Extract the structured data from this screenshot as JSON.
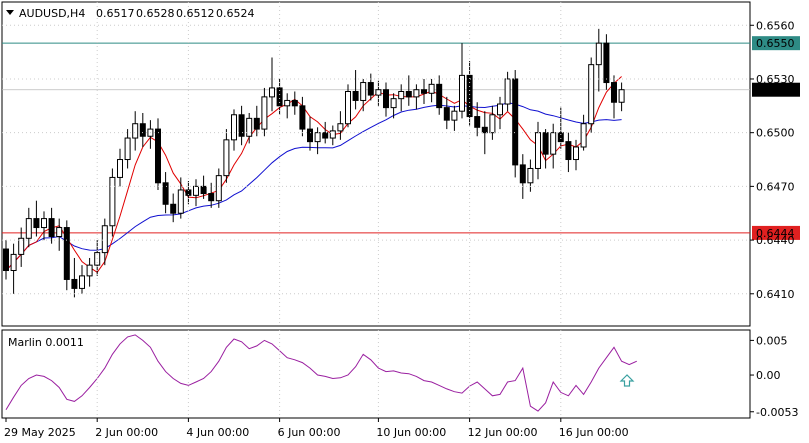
{
  "chart_data": {
    "type": "candlestick",
    "title": "AUDUSD,H4",
    "ohlc_header": {
      "open": "0.6517",
      "high": "0.6528",
      "low": "0.6512",
      "close": "0.6524"
    },
    "price_axis": {
      "ticks": [
        "0.6560",
        "0.6530",
        "0.6500",
        "0.6470",
        "0.6440",
        "0.6410"
      ],
      "range": [
        0.6392,
        0.6573
      ]
    },
    "x_axis_labels": [
      "29 May 2025",
      "2 Jun 00:00",
      "4 Jun 00:00",
      "6 Jun 00:00",
      "10 Jun 00:00",
      "12 Jun 00:00",
      "16 Jun 00:00"
    ],
    "horizontal_levels": [
      {
        "value": "0.6550",
        "color": "#2e8b85"
      },
      {
        "value": "0.6444",
        "color": "#e02020"
      }
    ],
    "current_price": "0.6524",
    "colors": {
      "fast_ma": "#e00000",
      "slow_ma": "#1010d0",
      "oscillator": "#9a1fa0",
      "arrow": "#3aa0a0",
      "grid": "#cccccc"
    },
    "candles": [
      [
        0.6435,
        0.644,
        0.6418,
        0.6423
      ],
      [
        0.6423,
        0.6438,
        0.641,
        0.6432
      ],
      [
        0.6432,
        0.6447,
        0.6425,
        0.6441
      ],
      [
        0.6441,
        0.6458,
        0.6436,
        0.6452
      ],
      [
        0.6452,
        0.6462,
        0.6442,
        0.6447
      ],
      [
        0.6447,
        0.6456,
        0.644,
        0.6452
      ],
      [
        0.6452,
        0.6458,
        0.6438,
        0.6442
      ],
      [
        0.6442,
        0.6452,
        0.6434,
        0.6447
      ],
      [
        0.6447,
        0.6451,
        0.6412,
        0.6418
      ],
      [
        0.6418,
        0.643,
        0.6408,
        0.6413
      ],
      [
        0.6413,
        0.6426,
        0.641,
        0.642
      ],
      [
        0.642,
        0.643,
        0.6414,
        0.6426
      ],
      [
        0.6426,
        0.644,
        0.642,
        0.6433
      ],
      [
        0.6433,
        0.6452,
        0.6426,
        0.6448
      ],
      [
        0.6448,
        0.648,
        0.6442,
        0.6475
      ],
      [
        0.6475,
        0.6491,
        0.647,
        0.6485
      ],
      [
        0.6485,
        0.6502,
        0.648,
        0.6497
      ],
      [
        0.6497,
        0.6512,
        0.649,
        0.6505
      ],
      [
        0.6505,
        0.6511,
        0.6492,
        0.6498
      ],
      [
        0.6498,
        0.6507,
        0.6491,
        0.6502
      ],
      [
        0.6502,
        0.6508,
        0.6468,
        0.6472
      ],
      [
        0.6472,
        0.6478,
        0.6455,
        0.646
      ],
      [
        0.646,
        0.6466,
        0.645,
        0.6455
      ],
      [
        0.6455,
        0.6475,
        0.6452,
        0.6468
      ],
      [
        0.6468,
        0.6473,
        0.646,
        0.6465
      ],
      [
        0.6465,
        0.6474,
        0.6459,
        0.647
      ],
      [
        0.647,
        0.6476,
        0.6463,
        0.6466
      ],
      [
        0.6466,
        0.6472,
        0.6458,
        0.6462
      ],
      [
        0.6462,
        0.648,
        0.6458,
        0.6476
      ],
      [
        0.6476,
        0.6502,
        0.6472,
        0.6496
      ],
      [
        0.6496,
        0.6513,
        0.649,
        0.651
      ],
      [
        0.651,
        0.6515,
        0.6493,
        0.6498
      ],
      [
        0.6498,
        0.6511,
        0.6494,
        0.6508
      ],
      [
        0.6508,
        0.6515,
        0.6498,
        0.6502
      ],
      [
        0.6502,
        0.6525,
        0.6498,
        0.652
      ],
      [
        0.652,
        0.6542,
        0.6512,
        0.6525
      ],
      [
        0.6525,
        0.653,
        0.651,
        0.6515
      ],
      [
        0.6515,
        0.6522,
        0.6508,
        0.6518
      ],
      [
        0.6518,
        0.6523,
        0.651,
        0.6515
      ],
      [
        0.6515,
        0.652,
        0.6498,
        0.6502
      ],
      [
        0.6502,
        0.6509,
        0.649,
        0.6495
      ],
      [
        0.6495,
        0.6503,
        0.6488,
        0.65
      ],
      [
        0.65,
        0.6506,
        0.6494,
        0.6497
      ],
      [
        0.6497,
        0.6504,
        0.6493,
        0.6501
      ],
      [
        0.6501,
        0.6512,
        0.6496,
        0.6505
      ],
      [
        0.6505,
        0.6527,
        0.6503,
        0.6523
      ],
      [
        0.6523,
        0.6535,
        0.6513,
        0.6518
      ],
      [
        0.6518,
        0.653,
        0.6512,
        0.6528
      ],
      [
        0.6528,
        0.6533,
        0.6518,
        0.6521
      ],
      [
        0.6521,
        0.6529,
        0.6515,
        0.6524
      ],
      [
        0.6524,
        0.6528,
        0.6509,
        0.6514
      ],
      [
        0.6514,
        0.6522,
        0.6508,
        0.6519
      ],
      [
        0.6519,
        0.6527,
        0.6512,
        0.6523
      ],
      [
        0.6523,
        0.6532,
        0.6515,
        0.652
      ],
      [
        0.652,
        0.6527,
        0.6513,
        0.6524
      ],
      [
        0.6524,
        0.653,
        0.6516,
        0.6522
      ],
      [
        0.6522,
        0.653,
        0.6517,
        0.6527
      ],
      [
        0.6527,
        0.6532,
        0.651,
        0.6514
      ],
      [
        0.6514,
        0.652,
        0.6502,
        0.6507
      ],
      [
        0.6507,
        0.6515,
        0.6501,
        0.6512
      ],
      [
        0.6512,
        0.655,
        0.6508,
        0.6532
      ],
      [
        0.6532,
        0.654,
        0.6504,
        0.6509
      ],
      [
        0.6509,
        0.6517,
        0.6498,
        0.6503
      ],
      [
        0.6503,
        0.6512,
        0.6488,
        0.65
      ],
      [
        0.65,
        0.6515,
        0.6496,
        0.651
      ],
      [
        0.651,
        0.652,
        0.6502,
        0.6516
      ],
      [
        0.6516,
        0.6534,
        0.6512,
        0.653
      ],
      [
        0.653,
        0.6535,
        0.6475,
        0.6482
      ],
      [
        0.6482,
        0.6488,
        0.6463,
        0.6472
      ],
      [
        0.6472,
        0.6485,
        0.6467,
        0.648
      ],
      [
        0.648,
        0.6506,
        0.6474,
        0.65
      ],
      [
        0.65,
        0.6502,
        0.648,
        0.6488
      ],
      [
        0.6488,
        0.6505,
        0.648,
        0.65
      ],
      [
        0.65,
        0.6514,
        0.6491,
        0.6495
      ],
      [
        0.6495,
        0.65,
        0.6478,
        0.6485
      ],
      [
        0.6485,
        0.6496,
        0.6479,
        0.6492
      ],
      [
        0.6492,
        0.651,
        0.649,
        0.6505
      ],
      [
        0.6505,
        0.6542,
        0.65,
        0.6538
      ],
      [
        0.6538,
        0.6558,
        0.6523,
        0.655
      ],
      [
        0.655,
        0.6555,
        0.6524,
        0.6528
      ],
      [
        0.6528,
        0.6532,
        0.6508,
        0.6517
      ],
      [
        0.6517,
        0.6528,
        0.6512,
        0.6524
      ]
    ],
    "oscillator": {
      "label": "Marlin 0.0011",
      "ticks": [
        "0.005",
        "0.00",
        "-0.0053"
      ],
      "range": [
        -0.0062,
        0.0065
      ],
      "values": [
        -0.005,
        -0.0032,
        -0.0015,
        -0.0005,
        0.0,
        -0.0002,
        -0.0008,
        -0.0018,
        -0.0035,
        -0.0038,
        -0.003,
        -0.0018,
        -0.0005,
        0.001,
        0.003,
        0.0045,
        0.0055,
        0.0058,
        0.005,
        0.004,
        0.002,
        0.0005,
        -0.0005,
        -0.0012,
        -0.0015,
        -0.001,
        -0.0005,
        0.0005,
        0.002,
        0.004,
        0.0052,
        0.0048,
        0.0038,
        0.0042,
        0.005,
        0.0045,
        0.0035,
        0.0025,
        0.0022,
        0.0018,
        0.001,
        0.0,
        -0.0002,
        -0.0005,
        -0.0004,
        0.0,
        0.0012,
        0.003,
        0.0022,
        0.001,
        0.0005,
        0.0006,
        0.0003,
        0.0002,
        -0.0002,
        -0.0008,
        -0.001,
        -0.0015,
        -0.002,
        -0.0024,
        -0.0026,
        -0.0016,
        -0.001,
        -0.002,
        -0.003,
        -0.0028,
        -0.001,
        -0.0008,
        0.001,
        -0.0045,
        -0.0052,
        -0.004,
        -0.001,
        -0.0025,
        -0.003,
        -0.0015,
        -0.0028,
        -0.001,
        0.001,
        0.0025,
        0.004,
        0.002,
        0.0015,
        0.002
      ]
    }
  }
}
